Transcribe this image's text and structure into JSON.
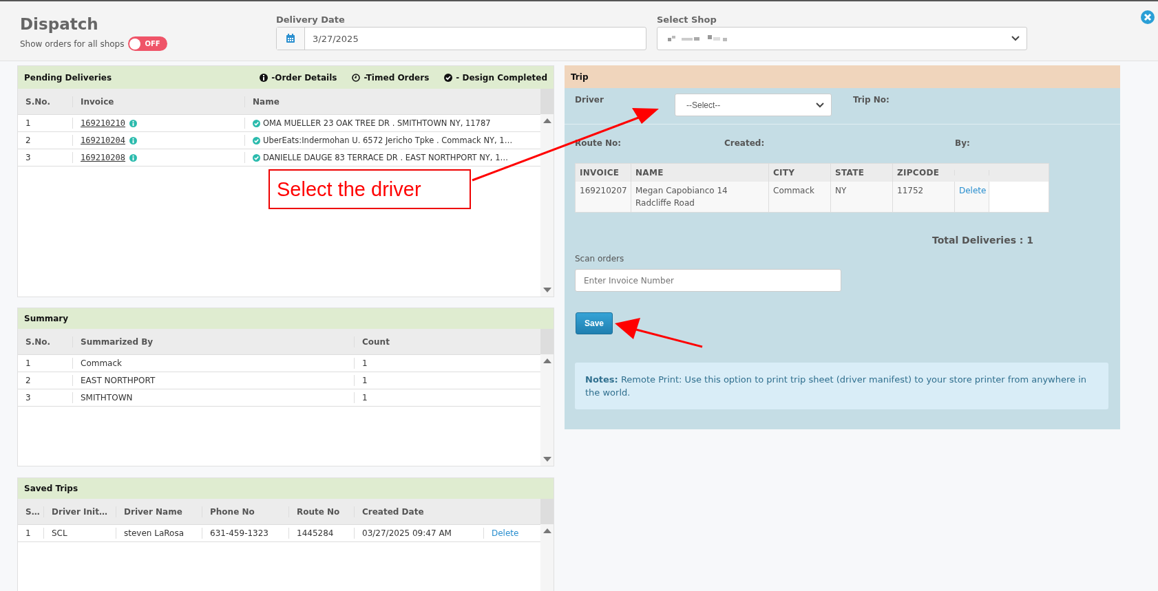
{
  "header": {
    "title": "Dispatch",
    "toggle": {
      "label": "Show orders for all shops",
      "on": false,
      "state_text": "OFF"
    },
    "delivery_date": {
      "label": "Delivery Date",
      "value": "3/27/2025"
    },
    "shop": {
      "label": "Select Shop"
    }
  },
  "pending": {
    "title": "Pending Deliveries",
    "legend": [
      {
        "kind": "info",
        "text": "-Order Details"
      },
      {
        "kind": "clock",
        "text": "-Timed Orders"
      },
      {
        "kind": "check",
        "text": "- Design Completed"
      }
    ],
    "columns": [
      "S.No.",
      "Invoice",
      "Name"
    ],
    "rows": [
      {
        "sno": "1",
        "invoice": "169210210",
        "design_completed": true,
        "name": "OMA MUELLER 23 OAK TREE DR . SMITHTOWN NY, 11787"
      },
      {
        "sno": "2",
        "invoice": "169210204",
        "design_completed": true,
        "name": "UberEats:Indermohan U. 6572 Jericho Tpke . Commack NY, 1…"
      },
      {
        "sno": "3",
        "invoice": "169210208",
        "design_completed": true,
        "name": "DANIELLE DAUGE 83 TERRACE DR . EAST NORTHPORT NY, 1…"
      }
    ]
  },
  "summary": {
    "title": "Summary",
    "columns": [
      "S.No.",
      "Summarized By",
      "Count"
    ],
    "rows": [
      {
        "sno": "1",
        "by": "Commack",
        "count": "1"
      },
      {
        "sno": "2",
        "by": "EAST NORTHPORT",
        "count": "1"
      },
      {
        "sno": "3",
        "by": "SMITHTOWN",
        "count": "1"
      }
    ]
  },
  "saved_trips": {
    "title": "Saved Trips",
    "columns": [
      "S…",
      "Driver Init…",
      "Driver Name",
      "Phone No",
      "Route No",
      "Created Date"
    ],
    "rows": [
      {
        "sno": "1",
        "initials": "SCL",
        "driver": "steven LaRosa",
        "phone": "631-459-1323",
        "route": "1445284",
        "created": "03/27/2025 09:47 AM",
        "action": "Delete"
      }
    ]
  },
  "trip": {
    "title": "Trip",
    "driver_label": "Driver",
    "driver_select": "--Select--",
    "trip_no_label": "Trip No:",
    "route_no_label": "Route No:",
    "created_label": "Created:",
    "by_label": "By:",
    "columns": [
      "INVOICE",
      "NAME",
      "CITY",
      "STATE",
      "ZIPCODE"
    ],
    "rows": [
      {
        "invoice": "169210207",
        "name": "Megan Capobianco 14 Radcliffe Road",
        "city": "Commack",
        "state": "NY",
        "zipcode": "11752",
        "action": "Delete"
      }
    ],
    "total": "Total Deliveries : 1",
    "scan_label": "Scan orders",
    "scan_placeholder": "Enter Invoice Number",
    "save": "Save",
    "notes": "**Notes:** Remote Print: Use this option to print trip sheet (driver manifest) to your store printer from anywhere in the world."
  },
  "annotation": {
    "callout": "Select the driver"
  }
}
